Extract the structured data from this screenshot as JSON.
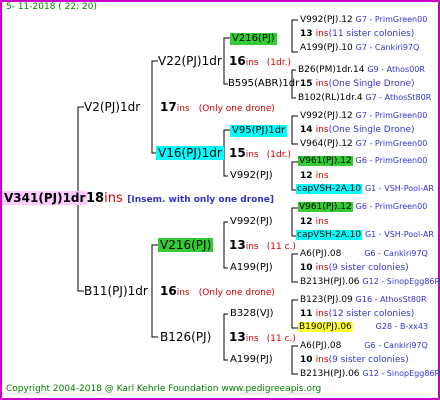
{
  "date": "5- 11-2018 ( 22: 20)",
  "copyright": "Copyright 2004-2018 @ Karl Kehrle Foundation   www.pedigreeapis.org",
  "root": {
    "label": "V341(PJ)1dr",
    "ins": "18",
    "ins_word": "ins",
    "note": "[Insem. with only one drone]"
  },
  "gen1": [
    {
      "label": "V2(PJ)1dr",
      "ins": "17",
      "ins_word": "ins",
      "note": "(Only one drone)"
    },
    {
      "label": "B11(PJ)1dr",
      "ins": "16",
      "ins_word": "ins",
      "note": "(Only one drone)"
    }
  ],
  "gen2": [
    {
      "label": "V22(PJ)1dr",
      "ins": "16",
      "ins_word": "ins",
      "note": "(1dr.)"
    },
    {
      "label": "V16(PJ)1dr",
      "ins": "15",
      "ins_word": "ins",
      "note": "(1dr.)"
    },
    {
      "label": "V216(PJ)",
      "ins": "13",
      "ins_word": "ins",
      "note": "(11 c.)"
    },
    {
      "label": "B126(PJ)",
      "ins": "13",
      "ins_word": "ins",
      "note": "(11 c.)"
    }
  ],
  "gen3": [
    {
      "label": "V216(PJ)"
    },
    {
      "label": "B595(ABR)1dr"
    },
    {
      "label": "V95(PJ)1dr"
    },
    {
      "label": "V992(PJ)"
    },
    {
      "label": "V992(PJ)"
    },
    {
      "label": "A199(PJ)"
    },
    {
      "label": "B328(VJ)"
    },
    {
      "label": "A199(PJ)"
    }
  ],
  "gen4": [
    {
      "name": "V992(PJ).12",
      "ref": "G7 - PrimGreen00",
      "ins": "13",
      "ins_word": "ins",
      "note": "(11 sister colonies)",
      "name2": "A199(PJ).10",
      "ref2": "G7 - Cankiri97Q"
    },
    {
      "name": "B26(PM)1dr.14",
      "ref": "G9 - Athos00R",
      "ins": "15",
      "ins_word": "ins",
      "note": "(One Single Drone)",
      "name2": "B102(RL)1dr.4",
      "ref2": "G7 - AthosSt80R"
    },
    {
      "name": "V992(PJ).12",
      "ref": "G7 - PrimGreen00",
      "ins": "14",
      "ins_word": "ins",
      "note": "(One Single Drone)",
      "name2": "V964(PJ).12",
      "ref2": "G7 - PrimGreen00"
    },
    {
      "name": "V961(PJ).12",
      "ref": "G6 - PrimGreen00",
      "ins": "12",
      "ins_word": "ins",
      "note": "",
      "name2": "capVSH-2A.10",
      "ref2": "G1 - VSH-Pool-AR"
    },
    {
      "name": "V961(PJ).12",
      "ref": "G6 - PrimGreen00",
      "ins": "12",
      "ins_word": "ins",
      "note": "",
      "name2": "capVSH-2A.10",
      "ref2": "G1 - VSH-Pool-AR"
    },
    {
      "name": "A6(PJ).08",
      "ref": "G6 - Cankiri97Q",
      "ins": "10",
      "ins_word": "ins",
      "note": "(9 sister colonies)",
      "name2": "B213H(PJ).06",
      "ref2": "G12 - SinopEgg86R"
    },
    {
      "name": "B123(PJ).09",
      "ref": "G16 - AthosSt80R",
      "ins": "11",
      "ins_word": "ins",
      "note": "(12 sister colonies)",
      "name2": "B190(PJ).06",
      "ref2": "G28 - B-xx43"
    },
    {
      "name": "A6(PJ).08",
      "ref": "G6 - Cankiri97Q",
      "ins": "10",
      "ins_word": "ins",
      "note": "(9 sister colonies)",
      "name2": "B213H(PJ).06",
      "ref2": "G12 - SinopEgg86R"
    }
  ]
}
